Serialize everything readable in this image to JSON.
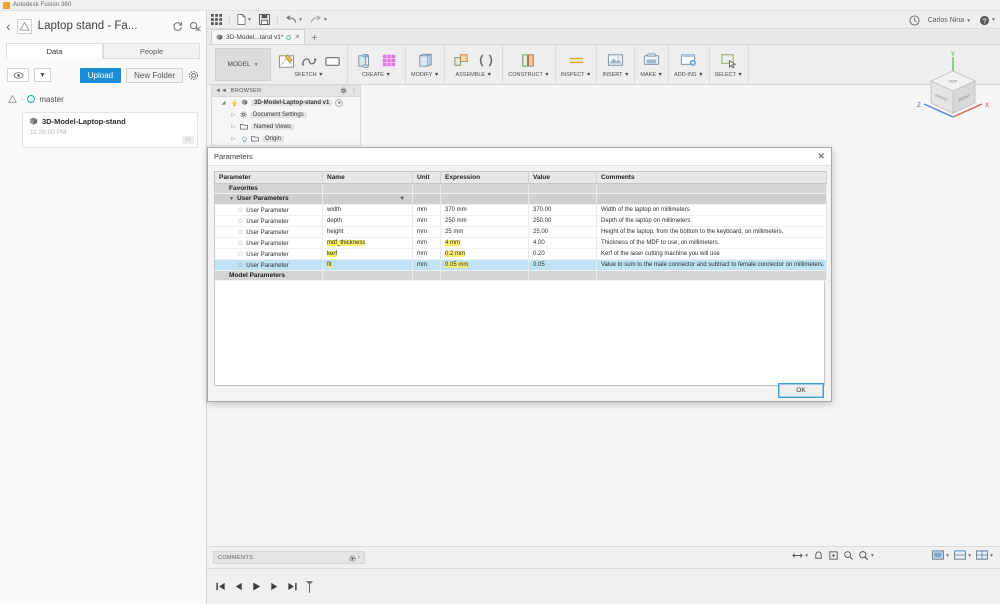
{
  "os": {
    "app_title": "Autodesk Fusion 360"
  },
  "data_panel": {
    "back_icon": "chevron-left-icon",
    "logo_icon": "autodesk-logo-icon",
    "title": "Laptop stand - Fa...",
    "refresh_icon": "refresh-icon",
    "search_icon": "search-icon",
    "close_icon": "close-icon",
    "tabs": [
      {
        "label": "Data",
        "active": true
      },
      {
        "label": "People",
        "active": false
      }
    ],
    "actions": {
      "eye_icon": "eye-icon",
      "caret_icon": "chevron-down-icon",
      "upload_label": "Upload",
      "new_folder_label": "New Folder",
      "gear_icon": "gear-icon"
    },
    "breadcrumb": {
      "home_icon": "autodesk-home-icon",
      "separator": "›",
      "project": "master"
    },
    "file_card": {
      "thumb_icon": "fusion-doc-icon",
      "name": "3D-Model-Laptop-stand",
      "time": "11:26:00 PM",
      "badge": "v1"
    }
  },
  "fusion": {
    "quick_access": {
      "grid_icon": "grid-icon",
      "file_icon": "file-icon",
      "save_icon": "save-icon",
      "undo_icon": "undo-icon",
      "redo_icon": "redo-icon",
      "history_icon": "clock-icon",
      "user_name": "Carlos Nina",
      "help_icon": "help-icon"
    },
    "document_tab": {
      "icon": "fusion-doc-icon",
      "label": "3D-Model...tand v1*",
      "status_dot": "sync-dot-icon",
      "close_icon": "close-icon",
      "new_tab_icon": "plus-icon"
    },
    "ribbon": {
      "workspace_label": "MODEL",
      "groups": [
        {
          "label": "SKETCH",
          "icons": [
            "create-sketch-icon",
            "spline-icon",
            "rectangle-icon"
          ]
        },
        {
          "label": "CREATE",
          "icons": [
            "extrude-icon",
            "mesh-icon"
          ]
        },
        {
          "label": "MODIFY",
          "icons": [
            "press-pull-icon"
          ]
        },
        {
          "label": "ASSEMBLE",
          "icons": [
            "new-component-icon",
            "joint-icon"
          ]
        },
        {
          "label": "CONSTRUCT",
          "icons": [
            "offset-plane-icon"
          ]
        },
        {
          "label": "INSPECT",
          "icons": [
            "measure-icon"
          ]
        },
        {
          "label": "INSERT",
          "icons": [
            "insert-mcmaster-icon"
          ]
        },
        {
          "label": "MAKE",
          "icons": [
            "3d-print-icon"
          ]
        },
        {
          "label": "ADD-INS",
          "icons": [
            "scripts-addins-icon"
          ]
        },
        {
          "label": "SELECT",
          "icons": [
            "select-icon"
          ]
        }
      ]
    },
    "browser": {
      "collapse_icon": "collapse-icon",
      "title": "BROWSER",
      "settings_icon": "gear-icon",
      "root": {
        "label": "3D-Model-Laptop-stand v1",
        "bulb_icon": "lightbulb-icon",
        "doc_icon": "component-icon",
        "badge_icon": "dot-icon"
      },
      "items": [
        {
          "label": "Document Settings",
          "icon": "gear-icon"
        },
        {
          "label": "Named Views",
          "icon": "folder-icon"
        },
        {
          "label": "Origin",
          "icon": "folder-icon",
          "bulb": true
        }
      ]
    },
    "view_cube": {
      "front_label": "FRONT",
      "top_label": "TOP",
      "right_label": "RIGHT",
      "axis_x": "X",
      "axis_y": "Y",
      "axis_z": "Z"
    },
    "comments": {
      "label": "COMMENTS",
      "gear_icon": "gear-icon"
    },
    "nav_bar": {
      "tools": [
        "orbit-icon",
        "pan-icon",
        "zoom-icon",
        "fit-icon"
      ],
      "display_tools": [
        "display-settings-icon",
        "grid-snap-icon",
        "viewports-icon"
      ]
    },
    "timeline": {
      "buttons": [
        "go-to-beginning-icon",
        "step-back-icon",
        "play-icon",
        "step-forward-icon",
        "go-to-end-icon",
        "marker-icon"
      ]
    }
  },
  "dialog": {
    "title": "Parameters",
    "close_icon": "close-icon",
    "columns": [
      "Parameter",
      "Name",
      "Unit",
      "Expression",
      "Value",
      "Comments"
    ],
    "groups": [
      {
        "label": "Favorites",
        "type": "group",
        "expandable": false
      },
      {
        "label": "User Parameters",
        "type": "group",
        "expandable": true,
        "add_icon": "+"
      }
    ],
    "rows": [
      {
        "parameter": "User Parameter",
        "name": "width",
        "unit": "mm",
        "expression": "370 mm",
        "value": "370.00",
        "comment": "Width of the laptop on millimeters",
        "highlight": false,
        "selected": false
      },
      {
        "parameter": "User Parameter",
        "name": "depth",
        "unit": "mm",
        "expression": "250 mm",
        "value": "250.00",
        "comment": "Depth of the laptop on millimeters",
        "highlight": false,
        "selected": false
      },
      {
        "parameter": "User Parameter",
        "name": "height",
        "unit": "mm",
        "expression": "25 mm",
        "value": "25.00",
        "comment": "Height of the laptop, from the bottom to the keyboard, on millimeters.",
        "highlight": false,
        "selected": false
      },
      {
        "parameter": "User Parameter",
        "name": "mdf_thickness",
        "unit": "mm",
        "expression": "4 mm",
        "value": "4.00",
        "comment": "Thickness of the MDF to use, on millimeters.",
        "highlight": true,
        "selected": false
      },
      {
        "parameter": "User Parameter",
        "name": "kerf",
        "unit": "mm",
        "expression": "0.2 mm",
        "value": "0.20",
        "comment": "Kerf of the laser cutting machine you will use",
        "highlight": true,
        "selected": false
      },
      {
        "parameter": "User Parameter",
        "name": "fit",
        "unit": "mm",
        "expression": "0.05 mm",
        "value": "0.05",
        "comment": "Value to sum to the male connector and subtract to female connector on millimeters.",
        "highlight": true,
        "selected": true
      }
    ],
    "footer_group": "Model Parameters",
    "ok_label": "OK"
  },
  "colors": {
    "accent_blue": "#1a8cd8",
    "highlight_yellow": "#f7f06b",
    "selection_blue": "#bfe2f5",
    "teal": "#16b19b"
  }
}
